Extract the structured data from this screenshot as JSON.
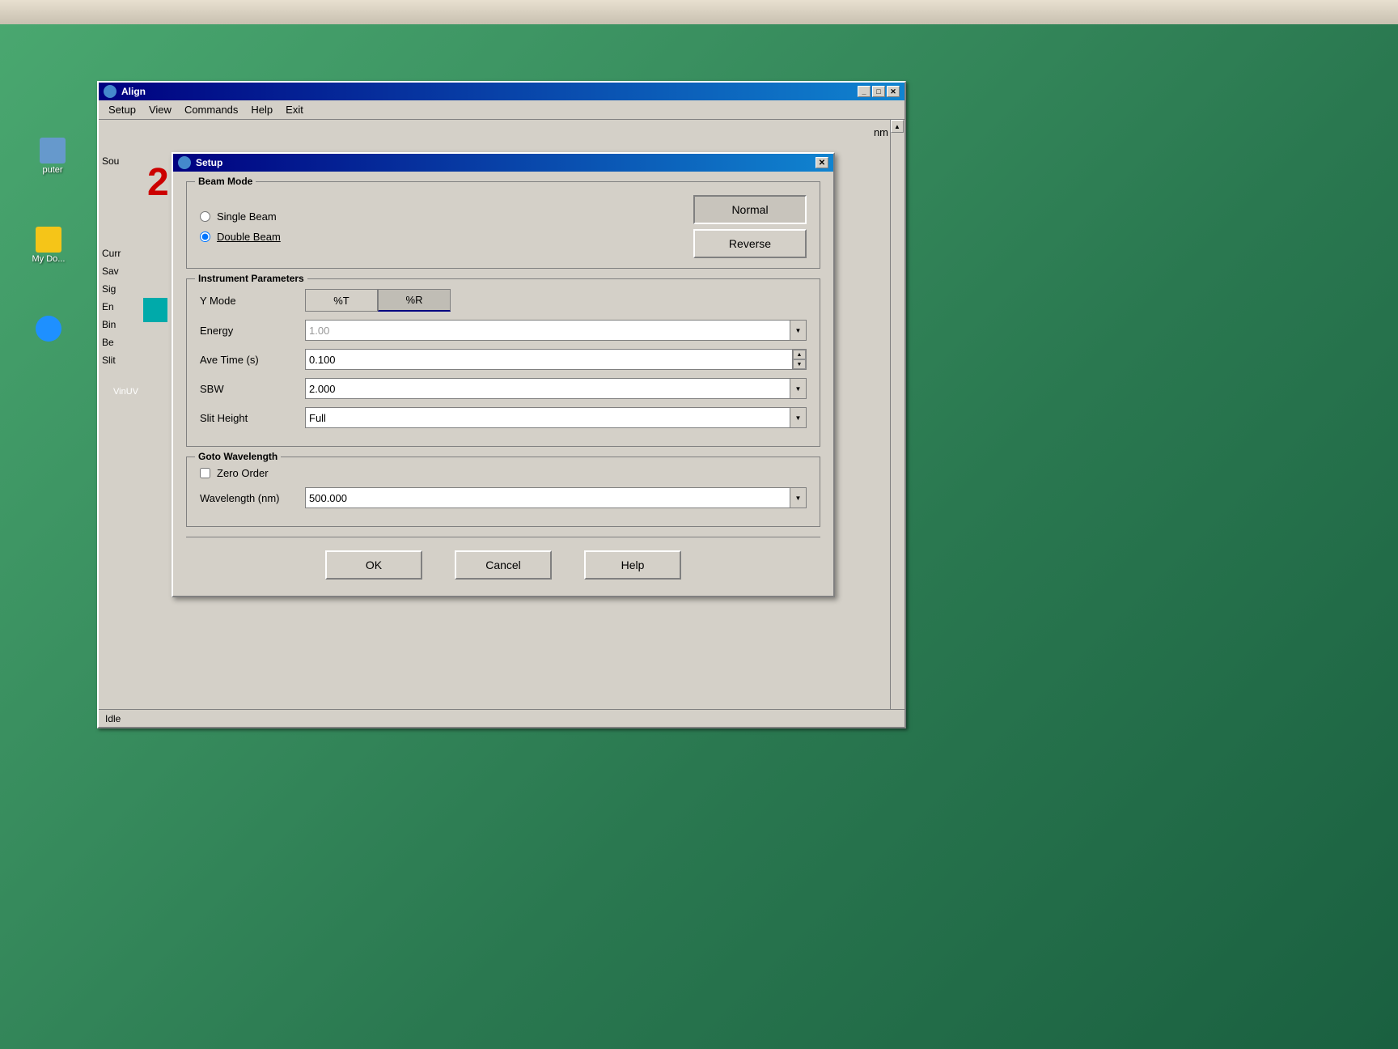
{
  "desktop": {
    "background_color": "#3a8a60"
  },
  "align_window": {
    "title": "Align",
    "menu_items": [
      "Setup",
      "View",
      "Commands",
      "Help",
      "Exit"
    ],
    "nm_label": "nm",
    "status": "Idle",
    "side_labels": [
      "Sou",
      "Curr",
      "Sav",
      "Sig",
      "En",
      "Bin",
      "Be",
      "Slit"
    ]
  },
  "setup_dialog": {
    "title": "Setup",
    "beam_mode": {
      "group_title": "Beam Mode",
      "single_beam_label": "Single Beam",
      "double_beam_label": "Double Beam",
      "double_beam_underline": true,
      "double_beam_selected": true,
      "normal_btn": "Normal",
      "reverse_btn": "Reverse"
    },
    "instrument_params": {
      "group_title": "Instrument Parameters",
      "y_mode_label": "Y Mode",
      "y_mode_pct_t": "%T",
      "y_mode_pct_r": "%R",
      "energy_label": "Energy",
      "energy_value": "1.00",
      "energy_disabled": true,
      "ave_time_label": "Ave Time (s)",
      "ave_time_value": "0.100",
      "sbw_label": "SBW",
      "sbw_value": "2.000",
      "slit_height_label": "Slit Height",
      "slit_height_value": "Full"
    },
    "goto_wavelength": {
      "group_title": "Goto Wavelength",
      "zero_order_label": "Zero Order",
      "zero_order_checked": false,
      "wavelength_label": "Wavelength (nm)",
      "wavelength_value": "500.000"
    },
    "buttons": {
      "ok": "OK",
      "cancel": "Cancel",
      "help": "Help"
    }
  },
  "icons": {
    "close": "✕",
    "minimize": "_",
    "maximize": "□",
    "dropdown": "▼",
    "spinner_up": "▲",
    "spinner_down": "▼"
  }
}
